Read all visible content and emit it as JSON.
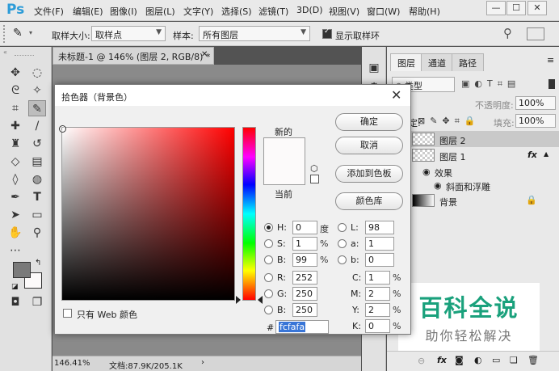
{
  "app": {
    "logo": "Ps"
  },
  "menu": [
    "文件(F)",
    "编辑(E)",
    "图像(I)",
    "图层(L)",
    "文字(Y)",
    "选择(S)",
    "滤镜(T)",
    "3D(D)",
    "视图(V)",
    "窗口(W)",
    "帮助(H)"
  ],
  "window_controls": {
    "minimize": "—",
    "maximize": "☐",
    "close": "✕"
  },
  "options": {
    "sample_size_label": "取样大小:",
    "sample_size_value": "取样点",
    "sample_label": "样本:",
    "sample_value": "所有图层",
    "show_ring_label": "显示取样环"
  },
  "document": {
    "tab_title": "未标题-1 @ 146% (图层 2, RGB/8) *",
    "tab_close": "✕",
    "zoom": "146.41%",
    "doc_info": "文档:87.9K/205.1K",
    "status_arrow": "›"
  },
  "layers_panel": {
    "tabs": [
      "图层",
      "通道",
      "路径"
    ],
    "kind_label": "类型",
    "opacity_label": "不透明度:",
    "opacity_value": "100%",
    "lock_label": "锁定:",
    "fill_label": "填充:",
    "fill_value": "100%",
    "layers": [
      {
        "name": "图层 2"
      },
      {
        "name": "图层 1",
        "fx": "fx"
      },
      {
        "name": "效果"
      },
      {
        "name": "斜面和浮雕"
      },
      {
        "name": "背景"
      }
    ]
  },
  "watermark": {
    "title": "百科全说",
    "subtitle": "助你轻松解决"
  },
  "color_picker": {
    "title": "拾色器（背景色）",
    "close": "✕",
    "new_label": "新的",
    "current_label": "当前",
    "new_color": "#fcfafa",
    "buttons": {
      "ok": "确定",
      "cancel": "取消",
      "add_to_swatches": "添加到色板",
      "color_libraries": "颜色库"
    },
    "only_web_colors": "只有 Web 颜色",
    "hsb": [
      {
        "label": "H:",
        "value": "0",
        "unit": "度",
        "selected": true
      },
      {
        "label": "S:",
        "value": "1",
        "unit": "%"
      },
      {
        "label": "B:",
        "value": "99",
        "unit": "%"
      }
    ],
    "rgb": [
      {
        "label": "R:",
        "value": "252"
      },
      {
        "label": "G:",
        "value": "250"
      },
      {
        "label": "B:",
        "value": "250"
      }
    ],
    "lab": [
      {
        "label": "L:",
        "value": "98"
      },
      {
        "label": "a:",
        "value": "1"
      },
      {
        "label": "b:",
        "value": "0"
      }
    ],
    "cmyk": [
      {
        "label": "C:",
        "value": "1",
        "unit": "%"
      },
      {
        "label": "M:",
        "value": "2",
        "unit": "%"
      },
      {
        "label": "Y:",
        "value": "2",
        "unit": "%"
      },
      {
        "label": "K:",
        "value": "0",
        "unit": "%"
      }
    ],
    "hex_label": "#",
    "hex_value": "fcfafa"
  }
}
